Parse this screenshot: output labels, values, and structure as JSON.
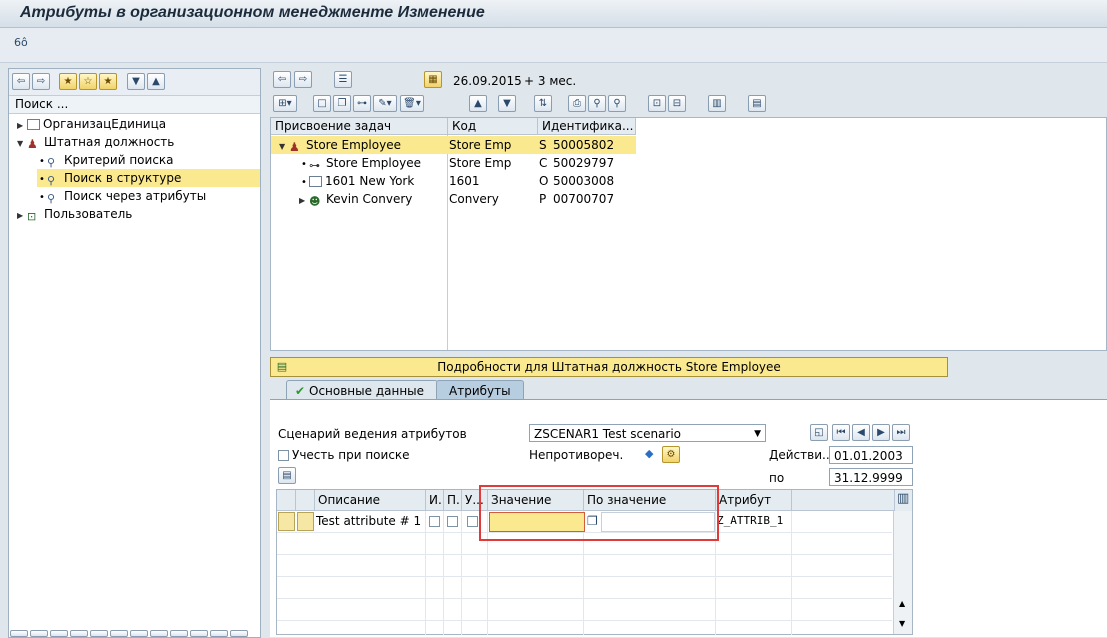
{
  "window": {
    "title": "Атрибуты в организационном менеджменте Изменение"
  },
  "app_toolbar": {
    "icon": "technical-info-icon",
    "icon_glyph": "6ô"
  },
  "left_panel": {
    "search_label": "Поиск ...",
    "tree": [
      {
        "label": "ОрганизацЕдиница",
        "icon": "org-unit-icon"
      },
      {
        "label": "Штатная должность",
        "icon": "position-icon"
      },
      {
        "label": "Критерий поиска",
        "icon": "binoculars-icon"
      },
      {
        "label": "Поиск в структуре",
        "icon": "binoculars-icon"
      },
      {
        "label": "Поиск через атрибуты",
        "icon": "binoculars-icon"
      },
      {
        "label": "Пользователь",
        "icon": "user-icon"
      }
    ]
  },
  "right_toolbar": {
    "date": "26.09.2015",
    "period": "+ 3 мес."
  },
  "grid": {
    "columns": [
      "Присвоение задач",
      "Код",
      "Идентифика..."
    ],
    "rows": [
      {
        "name": "Store Employee",
        "code": "Store Emp",
        "type": "S",
        "id": "50005802"
      },
      {
        "name": "Store Employee",
        "code": "Store Emp",
        "type": "C",
        "id": "50029797"
      },
      {
        "name": "1601 New York",
        "code": "1601",
        "type": "O",
        "id": "50003008"
      },
      {
        "name": "Kevin Convery",
        "code": "Convery",
        "type": "P",
        "id": "00700707"
      }
    ]
  },
  "details": {
    "header": "Подробности для Штатная должность Store Employee"
  },
  "tabs": [
    {
      "label": "Основные данные"
    },
    {
      "label": "Атрибуты"
    }
  ],
  "attributes": {
    "scenario_label": "Сценарий ведения атрибутов",
    "scenario_value": "ZSCENAR1 Test scenario",
    "consider_search_label": "Учесть при поиске",
    "consistent_label": "Непротивореч.",
    "valid_label": "Действи...",
    "valid_from": "01.01.2003",
    "to_label": "по",
    "valid_to": "31.12.9999",
    "table": {
      "columns": [
        "Описание",
        "И...",
        "П...",
        "У...",
        "Значение",
        "По значение",
        "Атрибут"
      ],
      "rows": [
        {
          "description": "Test attribute # 1",
          "value": "",
          "to_value": "",
          "attribute": "Z_ATTRIB_1"
        }
      ]
    }
  }
}
